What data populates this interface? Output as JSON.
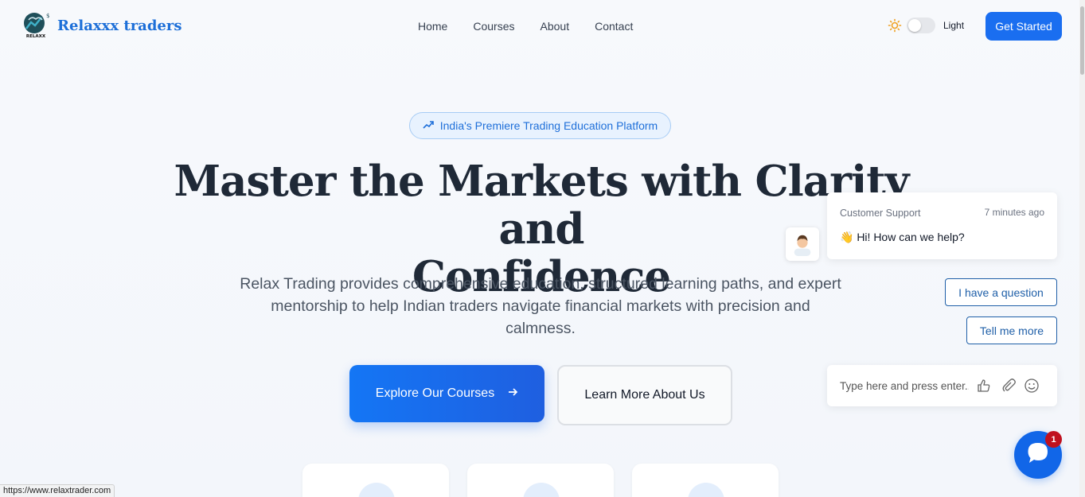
{
  "nav": {
    "brand": "Relaxxx traders",
    "logo_text": "RELAXX",
    "menu": [
      "Home",
      "Courses",
      "About",
      "Contact"
    ],
    "theme_label": "Light",
    "cta": "Get Started",
    "icons": {
      "logo": "bull-logo-icon",
      "theme": "sun-icon"
    }
  },
  "hero": {
    "badge": "India's Premiere Trading Education Platform",
    "headline_line1": "Master the Markets with Clarity and",
    "headline_line2": "Confidence",
    "subtitle": "Relax Trading provides comprehensive education, structured learning paths, and expert mentorship to help Indian traders navigate financial markets with precision and calmness.",
    "primary_button": "Explore Our Courses",
    "secondary_button": "Learn More About Us"
  },
  "chat": {
    "agent_name": "Customer Support",
    "time": "7 minutes ago",
    "message": "👋 Hi! How can we help?",
    "quick_replies": [
      "I have a question",
      "Tell me more"
    ],
    "input_placeholder": "Type here and press enter..",
    "unread_count": "1"
  },
  "status_bar": {
    "url": "https://www.relaxtrader.com"
  },
  "colors": {
    "accent": "#1a6ef0",
    "badge_bg": "#e8f2fe",
    "notification": "#c0111f"
  }
}
